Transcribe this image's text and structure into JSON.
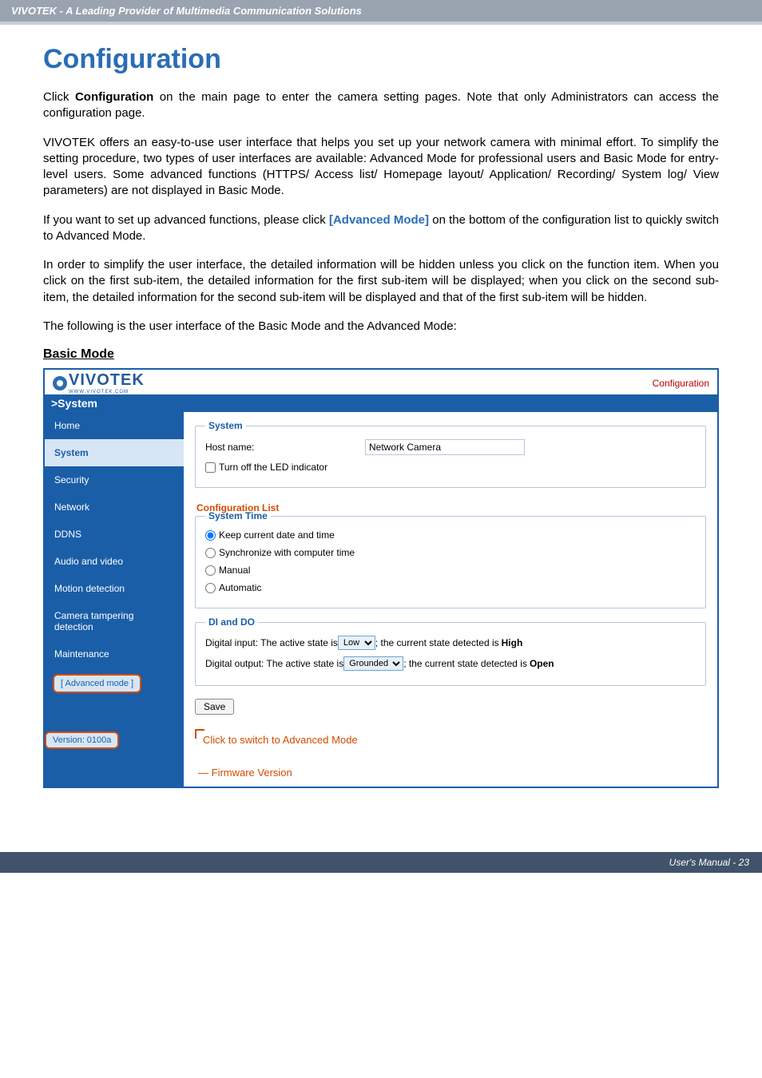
{
  "header": {
    "band": "VIVOTEK - A Leading Provider of Multimedia Communication Solutions"
  },
  "title": "Configuration",
  "paragraphs": {
    "p1a": "Click ",
    "p1b": "Configuration",
    "p1c": " on the main page to enter the camera setting pages. Note that only Administrators can access the configuration page.",
    "p2": "VIVOTEK offers an easy-to-use user interface that helps you set up your network camera with minimal effort. To simplify the setting procedure, two types of user interfaces are available: Advanced Mode for professional users and Basic Mode for entry-level users. Some advanced functions (HTTPS/ Access list/ Homepage layout/ Application/ Recording/ System log/ View parameters) are not displayed in Basic Mode.",
    "p3a": "If you want to set up advanced functions, please click ",
    "p3b": "[Advanced Mode]",
    "p3c": " on the bottom of the configuration list to quickly switch to Advanced Mode.",
    "p4": "In order to simplify the user interface, the detailed information will be hidden unless you click on the function item. When you click on the first sub-item, the detailed information for the first sub-item will be displayed; when you click on the second sub-item, the detailed information for the second sub-item will be displayed and that of the first sub-item will be hidden.",
    "p5": "The following is the user interface of the Basic Mode and the Advanced Mode:"
  },
  "section_heading": "Basic Mode",
  "ui": {
    "logo_text": "VIVOTEK",
    "logo_sub": "WWW.VIVOTEK.COM",
    "config_link": "Configuration",
    "system_bar": ">System",
    "nav": {
      "home": "Home",
      "system": "System",
      "security": "Security",
      "network": "Network",
      "ddns": "DDNS",
      "audio": "Audio and video",
      "motion": "Motion detection",
      "tamper": "Camera tampering detection",
      "maint": "Maintenance"
    },
    "adv_mode_btn": "[ Advanced mode ]",
    "version": "Version: 0100a",
    "panel": {
      "system_legend": "System",
      "host_label": "Host name:",
      "host_value": "Network Camera",
      "led_label": "Turn off the LED indicator",
      "cfg_list_label": "Configuration List",
      "systime_legend": "System Time",
      "keep": "Keep current date and time",
      "sync": "Synchronize with computer time",
      "manual": "Manual",
      "auto": "Automatic",
      "dido_legend": "DI and DO",
      "di_a": "Digital input: The active state is ",
      "di_sel": "Low",
      "di_b": " ; the current state detected is ",
      "di_c": "High",
      "do_a": "Digital output: The active state is ",
      "do_sel": "Grounded",
      "do_b": " ; the current state detected is ",
      "do_c": "Open",
      "save": "Save",
      "switch_note": "Click to switch to Advanced Mode",
      "fw_note": "Firmware Version"
    }
  },
  "footer": "User's Manual - 23"
}
